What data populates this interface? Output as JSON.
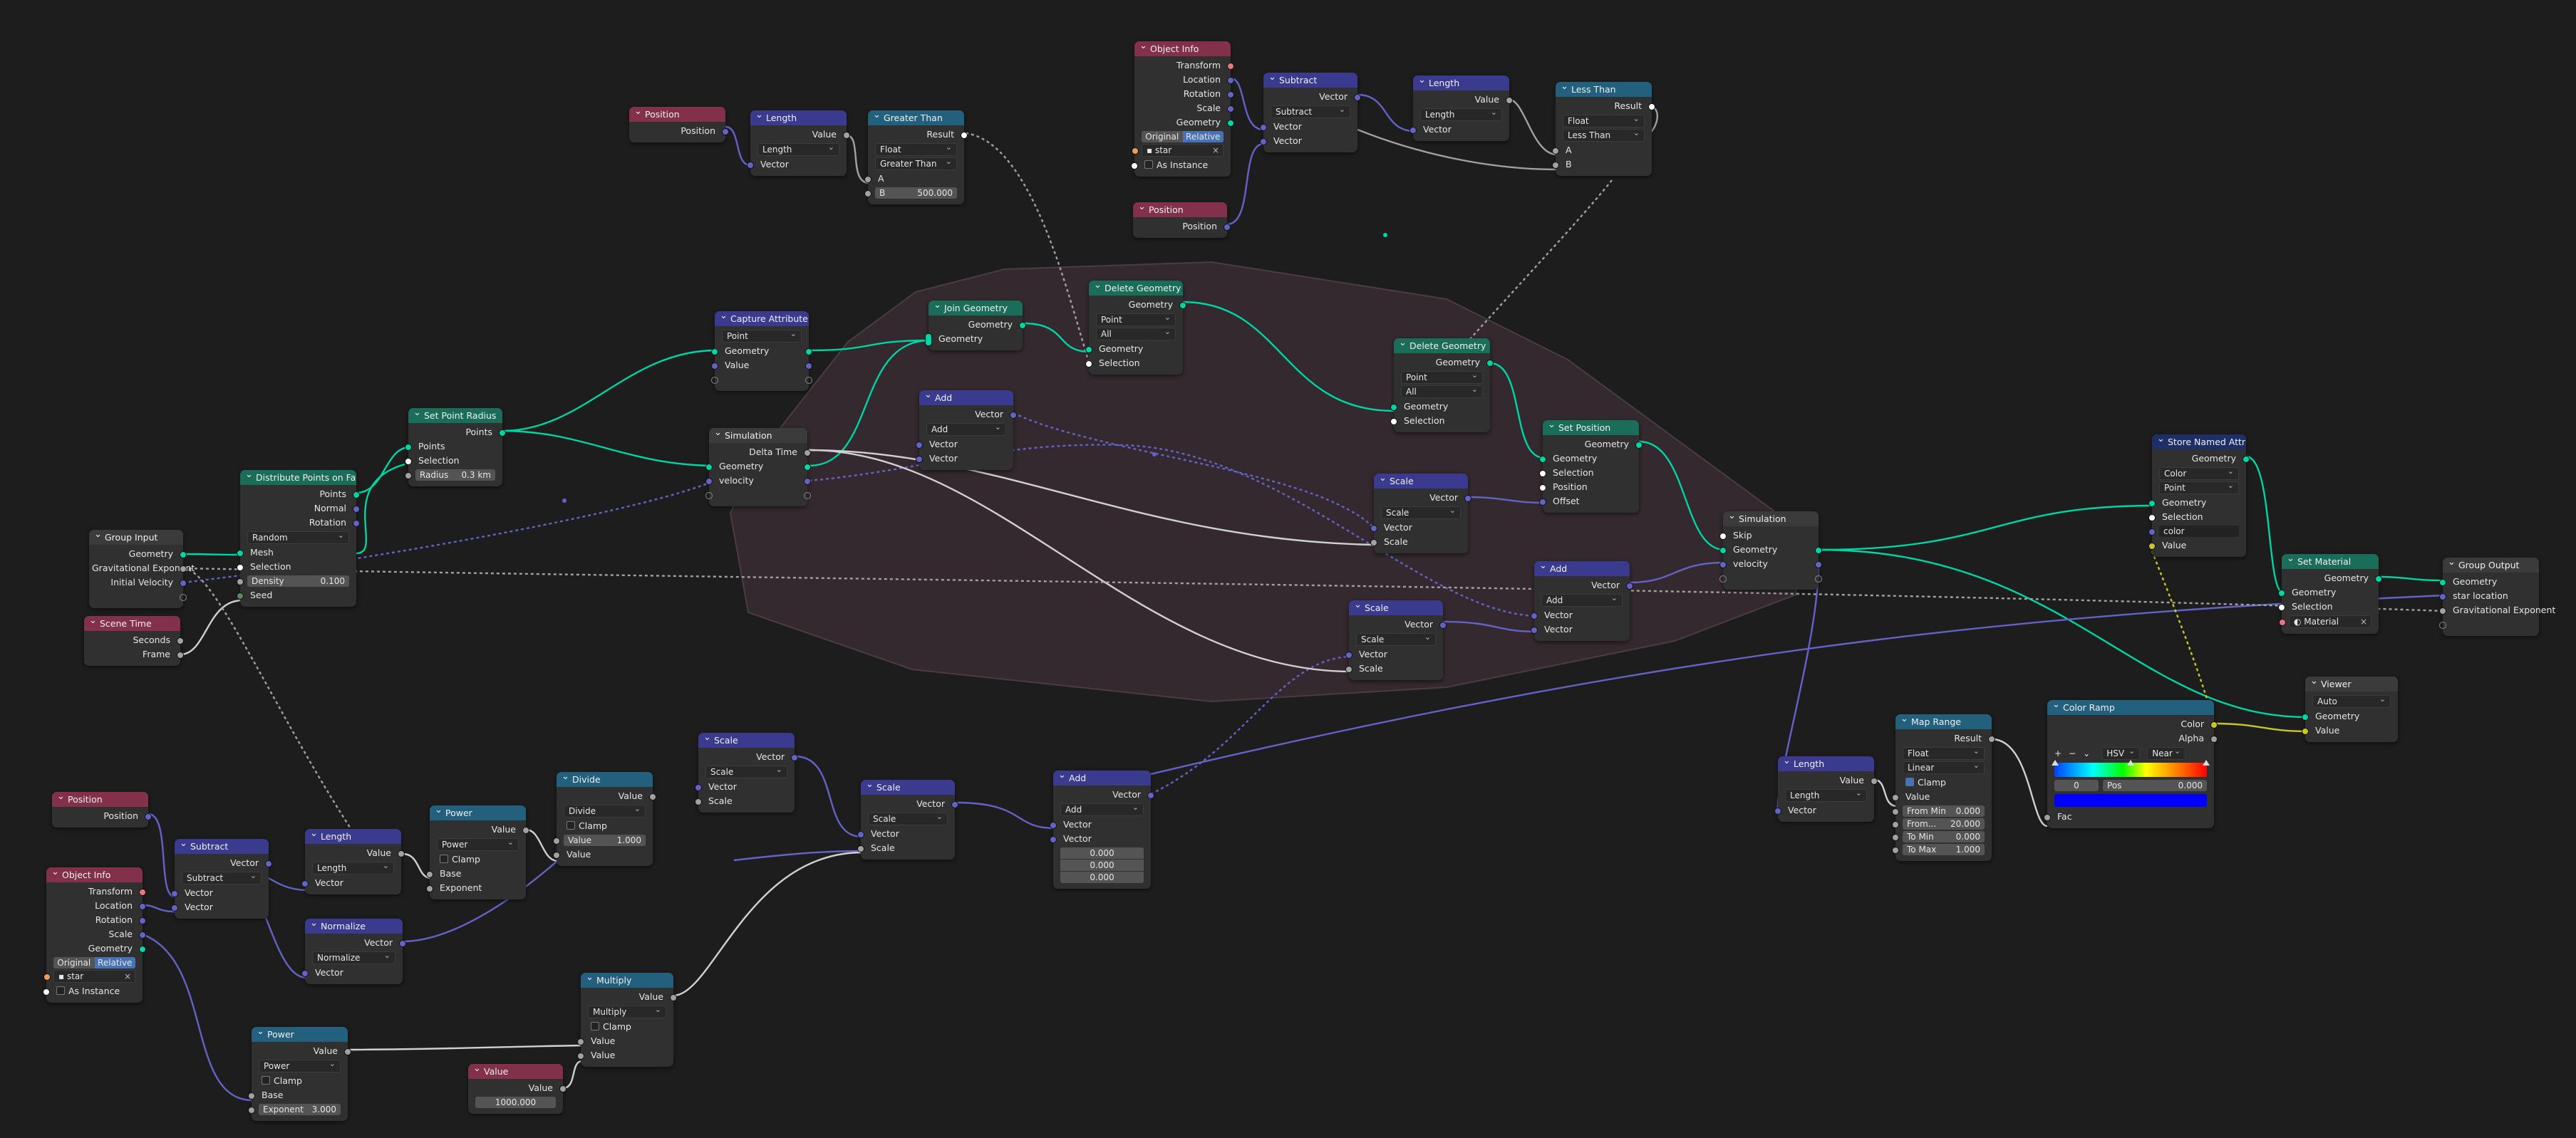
{
  "colors": {
    "geometry": "#00d6a3",
    "vector": "#6363c7",
    "float": "#a1a1a1",
    "color": "#c7c729",
    "shader": "#ffffff",
    "material": "#eb7582",
    "object": "#ed9e5c",
    "background": "#1d1d1d",
    "frame": "#3a2d33",
    "header_geometry": "#1a6d58",
    "header_vector": "#3a3a8f",
    "header_input": "#83314a",
    "header_converter": "#23607e"
  },
  "n_pos1": {
    "title": "Position",
    "out": "Position"
  },
  "n_len1": {
    "title": "Length",
    "out": "Value",
    "op": "Length",
    "in": "Vector"
  },
  "n_gt": {
    "title": "Greater Than",
    "out": "Result",
    "type": "Float",
    "op": "Greater Than",
    "a": "A",
    "b_label": "B",
    "b_val": "500.000"
  },
  "n_obj1": {
    "title": "Object Info",
    "o1": "Transform",
    "o2": "Location",
    "o3": "Rotation",
    "o4": "Scale",
    "o5": "Geometry",
    "seg1": "Original",
    "seg2": "Relative",
    "obj": "star",
    "inst": "As Instance"
  },
  "n_sub1": {
    "title": "Subtract",
    "out": "Vector",
    "op": "Subtract",
    "in1": "Vector",
    "in2": "Vector"
  },
  "n_len2": {
    "title": "Length",
    "out": "Value",
    "op": "Length",
    "in": "Vector"
  },
  "n_lt": {
    "title": "Less Than",
    "out": "Result",
    "type": "Float",
    "op": "Less Than",
    "a": "A",
    "b": "B"
  },
  "n_pos2": {
    "title": "Position",
    "out": "Position"
  },
  "n_cap": {
    "title": "Capture Attribute",
    "domain": "Point",
    "r1": "Geometry",
    "r2": "Value"
  },
  "n_join": {
    "title": "Join Geometry",
    "out": "Geometry",
    "in": "Geometry"
  },
  "n_del1": {
    "title": "Delete Geometry",
    "out": "Geometry",
    "dom": "Point",
    "mode": "All",
    "in1": "Geometry",
    "in2": "Selection"
  },
  "n_del2": {
    "title": "Delete Geometry",
    "out": "Geometry",
    "dom": "Point",
    "mode": "All",
    "in1": "Geometry",
    "in2": "Selection"
  },
  "n_spr": {
    "title": "Set Point Radius",
    "out": "Points",
    "in1": "Points",
    "in2": "Selection",
    "radius_label": "Radius",
    "radius_val": "0.3 km"
  },
  "n_simin": {
    "title": "Simulation",
    "o1": "Delta Time",
    "r1": "Geometry",
    "r2": "velocity"
  },
  "n_add1": {
    "title": "Add",
    "out": "Vector",
    "op": "Add",
    "in1": "Vector",
    "in2": "Vector"
  },
  "n_setpos": {
    "title": "Set Position",
    "out": "Geometry",
    "in1": "Geometry",
    "in2": "Selection",
    "in3": "Position",
    "in4": "Offset"
  },
  "n_scale1": {
    "title": "Scale",
    "out": "Vector",
    "op": "Scale",
    "in1": "Vector",
    "in2": "Scale"
  },
  "n_simout": {
    "title": "Simulation",
    "skip": "Skip",
    "r1": "Geometry",
    "r2": "velocity"
  },
  "n_add2": {
    "title": "Add",
    "out": "Vector",
    "op": "Add",
    "in1": "Vector",
    "in2": "Vector"
  },
  "n_scale2": {
    "title": "Scale",
    "out": "Vector",
    "op": "Scale",
    "in1": "Vector",
    "in2": "Scale"
  },
  "n_dist": {
    "title": "Distribute Points on Faces",
    "o1": "Points",
    "o2": "Normal",
    "o3": "Rotation",
    "mode": "Random",
    "in1": "Mesh",
    "in2": "Selection",
    "dens_label": "Density",
    "dens_val": "0.100",
    "in3": "Seed"
  },
  "n_gin": {
    "title": "Group Input",
    "o1": "Geometry",
    "o2": "Gravitational Exponent",
    "o3": "Initial Velocity"
  },
  "n_time": {
    "title": "Scene Time",
    "o1": "Seconds",
    "o2": "Frame"
  },
  "n_sna": {
    "title": "Store Named Attribute",
    "out": "Geometry",
    "type": "Color",
    "dom": "Point",
    "in1": "Geometry",
    "in2": "Selection",
    "name": "color",
    "in3": "Value"
  },
  "n_setmat": {
    "title": "Set Material",
    "out": "Geometry",
    "in1": "Geometry",
    "in2": "Selection",
    "mat": "Material"
  },
  "n_gout": {
    "title": "Group Output",
    "r1": "Geometry",
    "r2": "star location",
    "r3": "Gravitational Exponent"
  },
  "n_viewer": {
    "title": "Viewer",
    "dom": "Auto",
    "r1": "Geometry",
    "r2": "Value"
  },
  "n_ramp": {
    "title": "Color Ramp",
    "o1": "Color",
    "o2": "Alpha",
    "plus": "+",
    "minus": "−",
    "chev": "⌄",
    "mode": "HSV",
    "interp": "Near",
    "idx": "0",
    "pos_label": "Pos",
    "pos_val": "0.000",
    "fac": "Fac"
  },
  "n_maprange": {
    "title": "Map Range",
    "out": "Result",
    "type": "Float",
    "interp": "Linear",
    "clamp": "Clamp",
    "val": "Value",
    "f1l": "From Min",
    "f1v": "0.000",
    "f2l": "From...",
    "f2v": "20.000",
    "f3l": "To Min",
    "f3v": "0.000",
    "f4l": "To Max",
    "f4v": "1.000"
  },
  "n_len3": {
    "title": "Length",
    "out": "Value",
    "op": "Length",
    "in": "Vector"
  },
  "n_pos3": {
    "title": "Position",
    "out": "Position"
  },
  "n_obj2": {
    "title": "Object Info",
    "o1": "Transform",
    "o2": "Location",
    "o3": "Rotation",
    "o4": "Scale",
    "o5": "Geometry",
    "seg1": "Original",
    "seg2": "Relative",
    "obj": "star",
    "inst": "As Instance"
  },
  "n_sub2": {
    "title": "Subtract",
    "out": "Vector",
    "op": "Subtract",
    "in1": "Vector",
    "in2": "Vector"
  },
  "n_len4": {
    "title": "Length",
    "out": "Value",
    "op": "Length",
    "in": "Vector"
  },
  "n_power1": {
    "title": "Power",
    "out": "Value",
    "op": "Power",
    "clamp": "Clamp",
    "in1": "Base",
    "in2": "Exponent"
  },
  "n_norm": {
    "title": "Normalize",
    "out": "Vector",
    "op": "Normalize",
    "in": "Vector"
  },
  "n_div": {
    "title": "Divide",
    "out": "Value",
    "op": "Divide",
    "clamp": "Clamp",
    "val_label": "Value",
    "val_val": "1.000",
    "in2": "Value"
  },
  "n_scale3": {
    "title": "Scale",
    "out": "Vector",
    "op": "Scale",
    "in1": "Vector",
    "in2": "Scale"
  },
  "n_scale4": {
    "title": "Scale",
    "out": "Vector",
    "op": "Scale",
    "in1": "Vector",
    "in2": "Scale"
  },
  "n_add3": {
    "title": "Add",
    "out": "Vector",
    "op": "Add",
    "in1": "Vector",
    "in2": "Vector",
    "v1": "0.000",
    "v2": "0.000",
    "v3": "0.000"
  },
  "n_mult": {
    "title": "Multiply",
    "out": "Value",
    "op": "Multiply",
    "clamp": "Clamp",
    "in1": "Value",
    "in2": "Value"
  },
  "n_power2": {
    "title": "Power",
    "out": "Value",
    "op": "Power",
    "clamp": "Clamp",
    "in1": "Base",
    "exp_label": "Exponent",
    "exp_val": "3.000"
  },
  "n_value": {
    "title": "Value",
    "out": "Value",
    "val": "1000.000"
  }
}
